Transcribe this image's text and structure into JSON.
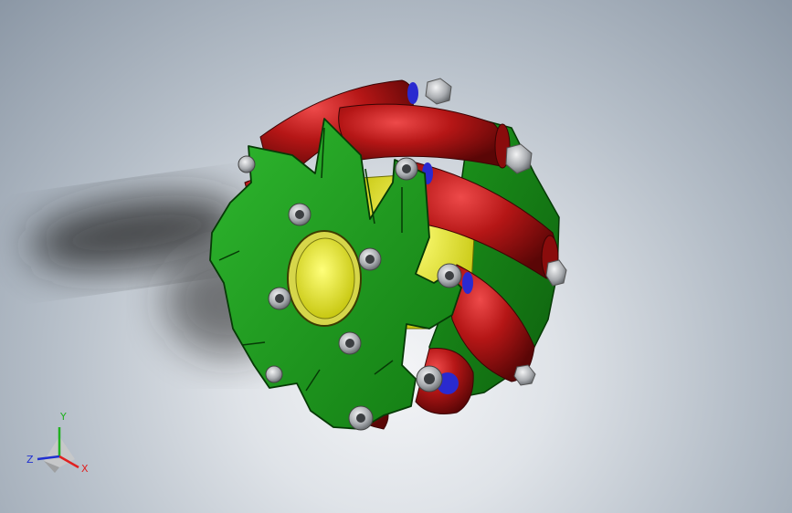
{
  "view": {
    "type": "3D CAD model viewport",
    "model": "mecanum-wheel",
    "colors": {
      "background_top": "#8b97a5",
      "background_center": "#f4f5f7",
      "side_plate": "#1f9a1f",
      "roller": "#b01414",
      "hub": "#e8e820",
      "bolt": "#b9bcbf",
      "shadow": "#2a2a2a"
    }
  },
  "triad": {
    "x_label": "X",
    "y_label": "Y",
    "z_label": "Z",
    "x_color": "#e02020",
    "y_color": "#20b020",
    "z_color": "#2030d0"
  }
}
